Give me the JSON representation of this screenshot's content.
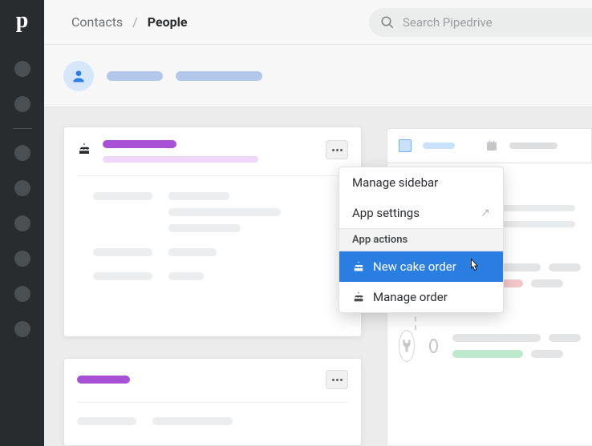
{
  "breadcrumb": {
    "parent": "Contacts",
    "current": "People"
  },
  "search": {
    "placeholder": "Search Pipedrive"
  },
  "menu": {
    "manage_sidebar": "Manage sidebar",
    "app_settings": "App settings",
    "section": "App actions",
    "new_cake": "New cake order",
    "manage_order": "Manage order"
  }
}
